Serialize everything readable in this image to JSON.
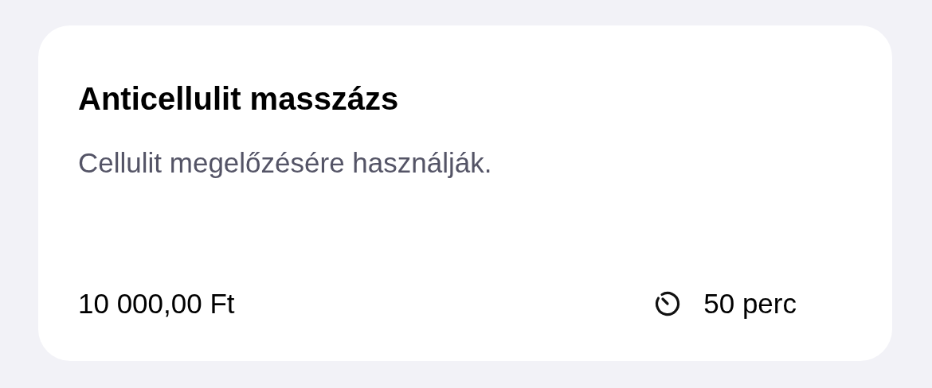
{
  "service": {
    "title": "Anticellulit masszázs",
    "description": "Cellulit megelőzésére használják.",
    "price": "10 000,00 Ft",
    "duration": "50 perc"
  }
}
